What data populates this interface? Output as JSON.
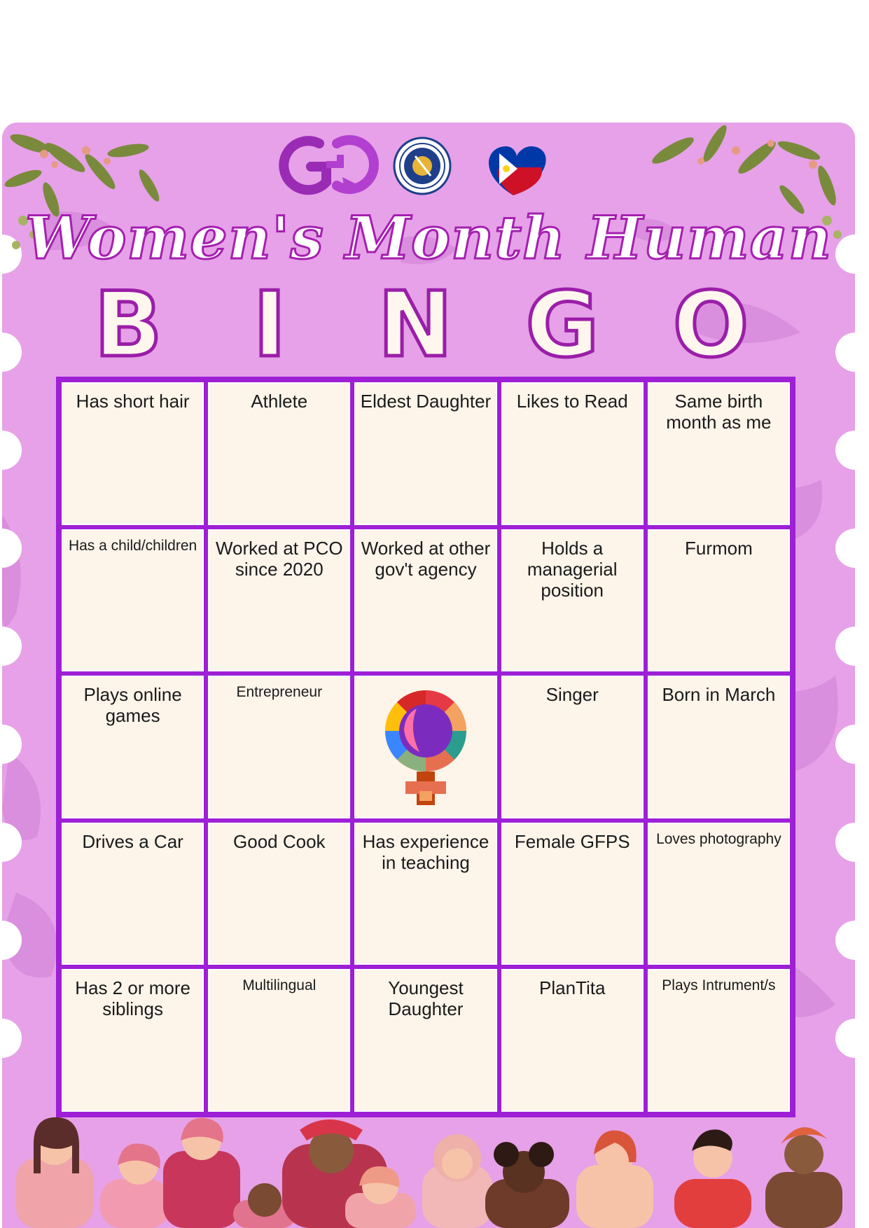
{
  "title": "Women's Month Human",
  "bingo_letters": [
    "B",
    "I",
    "N",
    "G",
    "O"
  ],
  "logos": {
    "left": "gad-logo",
    "middle": "pco-seal-icon",
    "right": "philippine-flag-heart-icon",
    "seal_text": "PRESIDENTIAL COMMUNICATIONS OFFICE · PHILIPPINES"
  },
  "colors": {
    "background": "#e6a1e8",
    "grid_border": "#9e1fd6",
    "cell": "#fdf4ea",
    "title_stroke": "#a51fb0"
  },
  "grid": [
    [
      "Has short hair",
      "Athlete",
      "Eldest Daughter",
      "Likes to Read",
      "Same birth month as me"
    ],
    [
      "Has a child/children",
      "Worked at PCO since 2020",
      "Worked at other gov't agency",
      "Holds a managerial position",
      "Furmom"
    ],
    [
      "Plays online games",
      "Entrepreneur",
      "",
      "Singer",
      "Born in March"
    ],
    [
      "Drives a Car",
      "Good Cook",
      "Has experience in teaching",
      "Female GFPS",
      "Loves photography"
    ],
    [
      "Has 2 or more siblings",
      "Multilingual",
      "Youngest Daughter",
      "PlanTita",
      "Plays Intrument/s"
    ]
  ],
  "free_space_icon": "female-symbol-mosaic-icon"
}
